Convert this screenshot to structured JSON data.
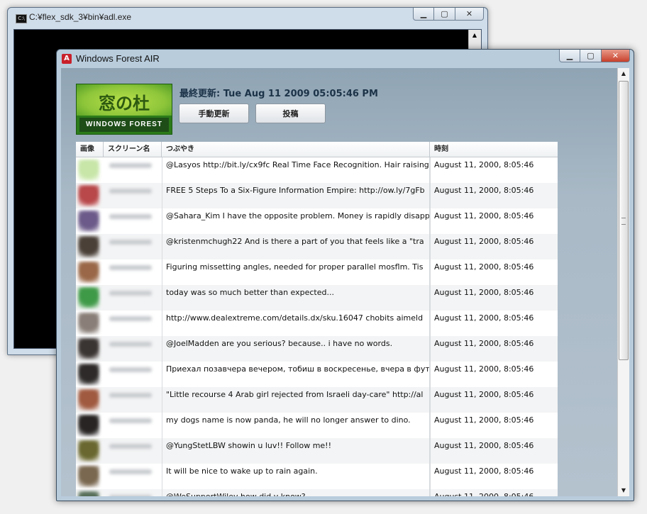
{
  "console": {
    "title": "C:¥flex_sdk_3¥bin¥adl.exe",
    "icon": "console-icon",
    "caption_buttons": [
      "minimize",
      "maximize",
      "close"
    ]
  },
  "air": {
    "title": "Windows Forest AIR",
    "icon": "adobe-air-icon",
    "caption_buttons": [
      "minimize",
      "maximize",
      "close"
    ],
    "logo": {
      "top_text": "窓の杜",
      "bottom_text": "WINDOWS  FOREST"
    },
    "last_updated": "最終更新: Tue Aug 11 2009 05:05:46 PM",
    "buttons": {
      "refresh": "手動更新",
      "post": "投稿"
    },
    "columns": {
      "image": "画像",
      "screen_name": "スクリーン名",
      "tweet": "つぶやき",
      "time": "時刻"
    },
    "rows": [
      {
        "tweet": "@Lasyos http://bit.ly/cx9fc Real Time Face Recognition. Hair raising",
        "time": "August 11, 2000, 8:05:46",
        "avatar_color": "#c8e6a8"
      },
      {
        "tweet": "FREE 5 Steps To a Six-Figure Information Empire: http://ow.ly/7gFb",
        "time": "August 11, 2000, 8:05:46",
        "avatar_color": "#b8484a"
      },
      {
        "tweet": "@Sahara_Kim I have the opposite problem. Money is rapidly disappearing",
        "time": "August 11, 2000, 8:05:46",
        "avatar_color": "#6c5b8a"
      },
      {
        "tweet": "@kristenmchugh22 And is there a part of you that feels like a \"tra",
        "time": "August 11, 2000, 8:05:46",
        "avatar_color": "#4a4038"
      },
      {
        "tweet": "Figuring missetting angles, needed for proper parallel mosflm. Tis",
        "time": "August 11, 2000, 8:05:46",
        "avatar_color": "#9a6848"
      },
      {
        "tweet": "today was so much better than expected...",
        "time": "August 11, 2000, 8:05:46",
        "avatar_color": "#3f9a48"
      },
      {
        "tweet": "http://www.dealextreme.com/details.dx/sku.16047 chobits aimeld",
        "time": "August 11, 2000, 8:05:46",
        "avatar_color": "#8a7f78"
      },
      {
        "tweet": "@JoelMadden are you serious? because.. i have no words.",
        "time": "August 11, 2000, 8:05:46",
        "avatar_color": "#3a3432"
      },
      {
        "tweet": "Приехал позавчера вечером, тобиш в воскресенье, вчера в футбол",
        "time": "August 11, 2000, 8:05:46",
        "avatar_color": "#2e2a2a"
      },
      {
        "tweet": "\"Little recourse 4 Arab girl rejected from Israeli day-care\" http://al",
        "time": "August 11, 2000, 8:05:46",
        "avatar_color": "#a05a40"
      },
      {
        "tweet": "my dogs name is now panda, he will no longer answer to dino.",
        "time": "August 11, 2000, 8:05:46",
        "avatar_color": "#282424"
      },
      {
        "tweet": "@YungStetLBW showin u luv!! Follow me!!",
        "time": "August 11, 2000, 8:05:46",
        "avatar_color": "#6a6830"
      },
      {
        "tweet": "It will be nice to wake up to rain again.",
        "time": "August 11, 2000, 8:05:46",
        "avatar_color": "#7a6850"
      },
      {
        "tweet": "@WeSupportWiley how did y know? ......",
        "time": "August 11, 2000, 8:05:46",
        "avatar_color": "#58705a"
      }
    ]
  }
}
